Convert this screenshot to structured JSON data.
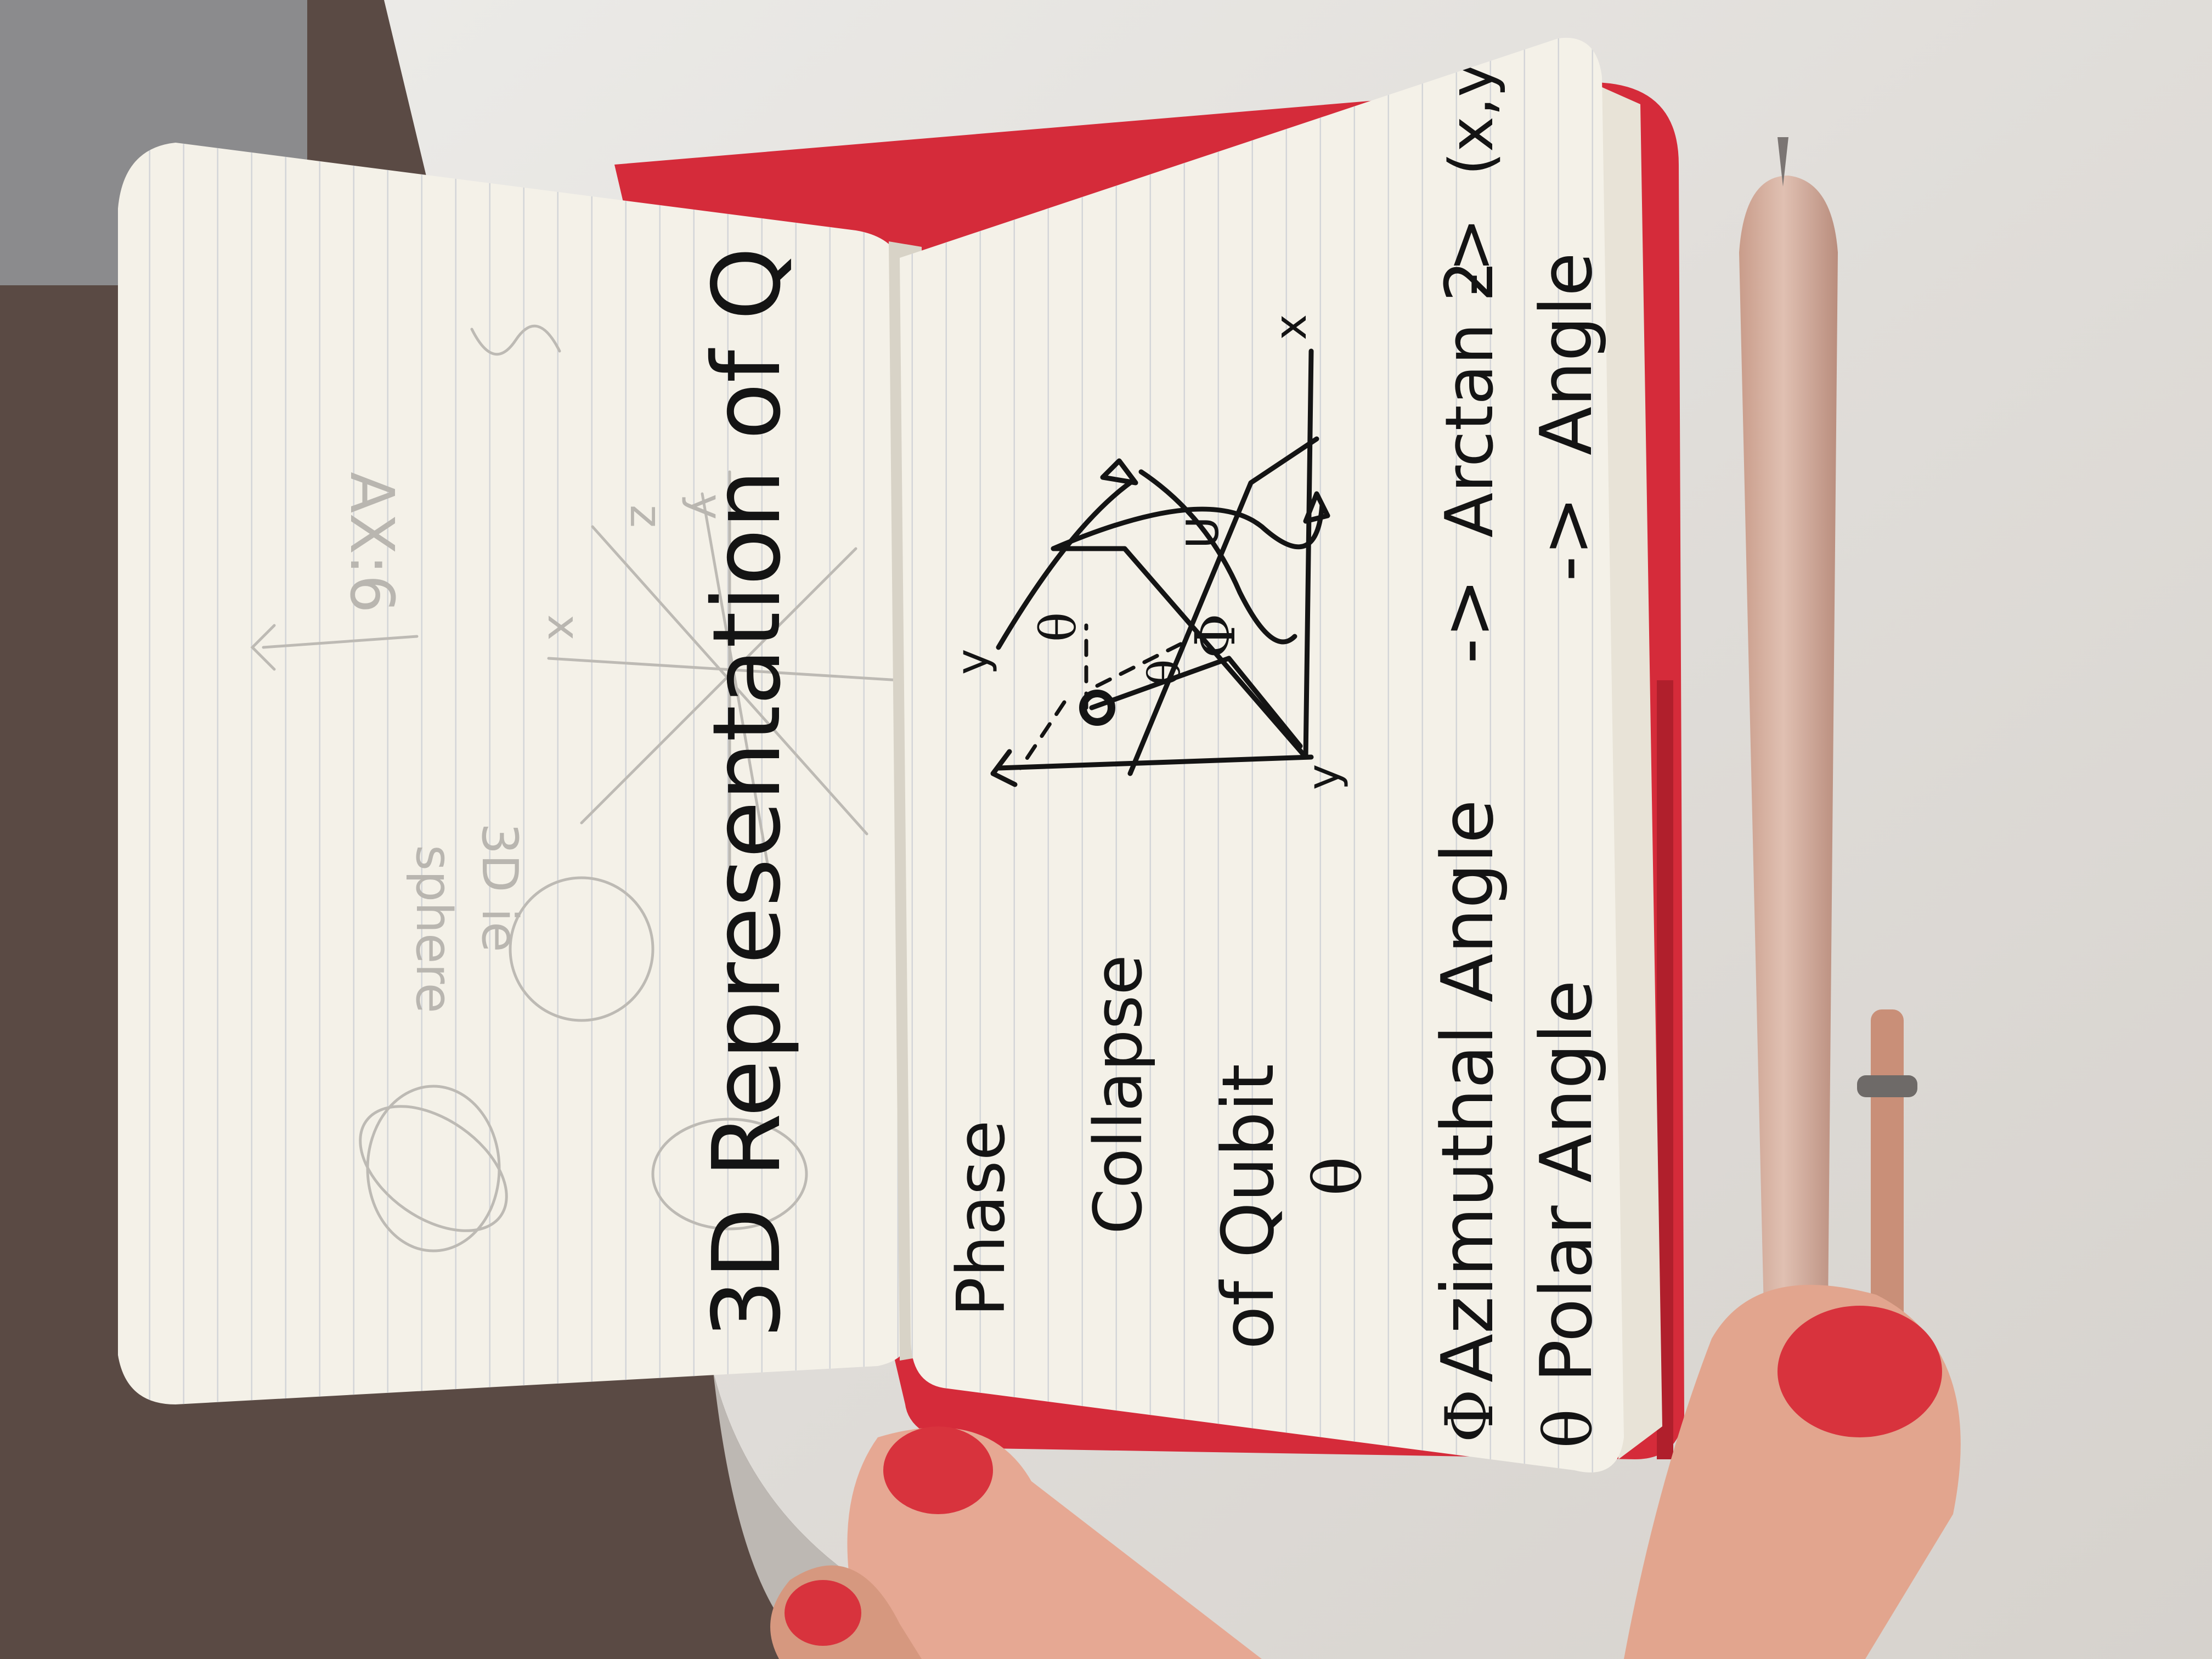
{
  "scene": {
    "description_icon": "notebook-photo",
    "colors": {
      "paper": "#f4f1e8",
      "rule_line": "#cfd2d6",
      "notebook_cover": "#d52b3a",
      "pen": "#d8b3a3",
      "ink": "#141414",
      "nail_polish": "#d8333d",
      "marble": "#e7e4e0",
      "wood_floor": "#5a4a44"
    }
  },
  "left_page": {
    "heading": "3D Representation of Q",
    "ghost_text": {
      "ax": "AX:6",
      "sphere_label_1": "3D ie",
      "sphere_label_2": "sphere",
      "axis_x": "x",
      "axis_y": "y",
      "axis_z": "z"
    }
  },
  "right_page": {
    "lines": {
      "phase": "Phase",
      "collapse": "Collapse",
      "of_qubit": "of Qubit",
      "azimuthal": "Azimuthal Angle",
      "polar": "Polar Angle",
      "arrow_1": "->",
      "arrow_2": "->",
      "angle_1": "Angle",
      "angle_2": "Angle",
      "arctan": "Arctan 2",
      "xyz": "(x,y,z)"
    },
    "symbols": {
      "phi": "Φ",
      "theta": "θ"
    },
    "diagram_labels": {
      "x_top": "x",
      "y_bottom": "y",
      "y_left": "y",
      "theta_1": "θ",
      "theta_2": "θ",
      "phi_1": "Φ",
      "u_mark": "U"
    }
  }
}
